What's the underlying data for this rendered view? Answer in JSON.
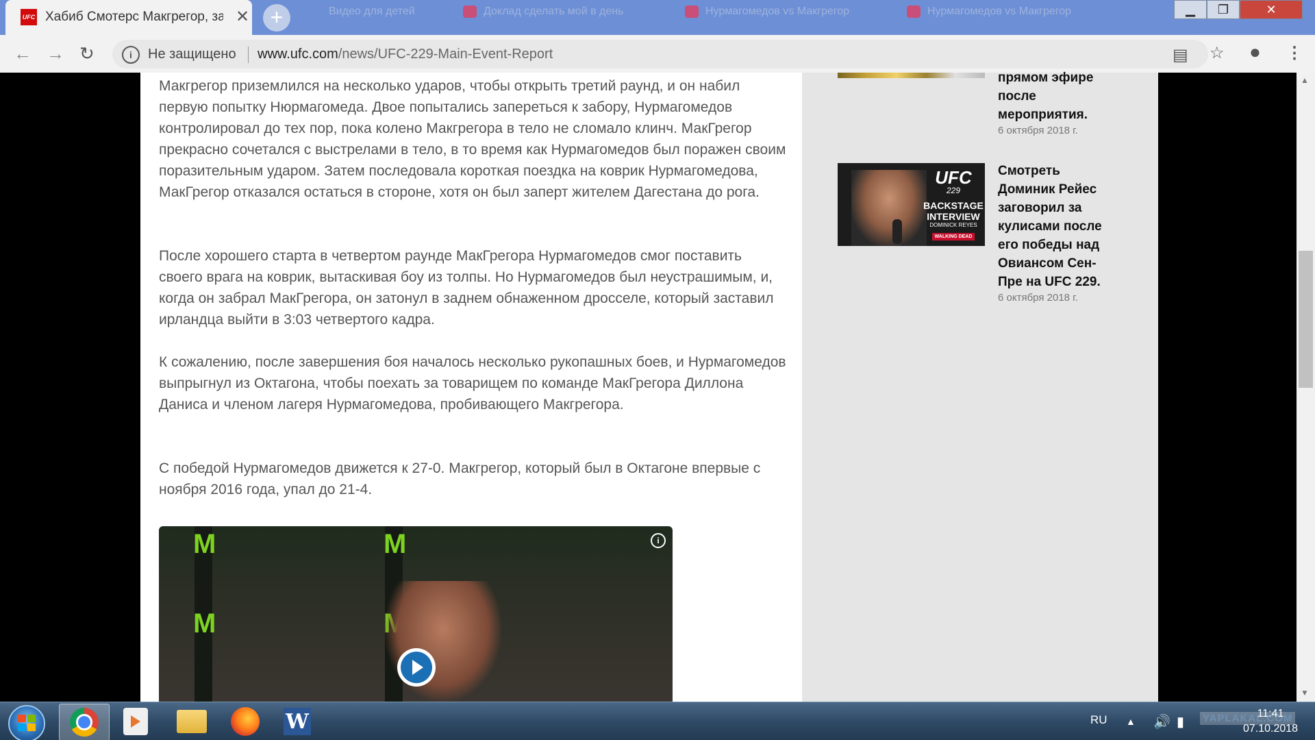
{
  "browser": {
    "active_tab": {
      "favicon_text": "UFC",
      "title": "Хабиб Смотерс Макгрегор, защ",
      "close_glyph": "✕"
    },
    "new_tab_glyph": "+",
    "background_tabs": [
      {
        "title": "Видео для детей",
        "close_glyph": "✕"
      },
      {
        "title": "Доклад сделать мой в день",
        "close_glyph": "✕"
      },
      {
        "title": "Нурмагомедов vs Макгрегор",
        "close_glyph": "✕"
      },
      {
        "title": "Нурмагомедов vs Макгрегор",
        "close_glyph": "✕"
      }
    ],
    "window_controls": {
      "minimize": "▁",
      "maximize": "❐",
      "close": "✕"
    },
    "address_bar": {
      "security_label": "Не защищено",
      "url_domain": "www.ufc.com",
      "url_path": "/news/UFC-229-Main-Event-Report"
    }
  },
  "article": {
    "paragraphs": [
      "Макгрегор приземлился на несколько ударов, чтобы открыть третий раунд, и он набил первую попытку Нюрмагомеда. Двое попытались запереться к забору, Нурмагомедов контролировал до тех пор, пока колено Макгрегора в тело не сломало клинч. МакГрегор прекрасно сочетался с выстрелами в тело, в то время как Нурмагомедов был поражен своим поразительным ударом. Затем последовала короткая поездка на коврик Нурмагомедова, МакГрегор отказался остаться в стороне, хотя он был заперт жителем Дагестана до рога.",
      "После хорошего старта в четвертом раунде МакГрегора Нурмагомедов смог поставить своего врага на коврик, вытаскивая боу из толпы. Но Нурмагомедов был неустрашимым, и, когда он забрал МакГрегора, он затонул в заднем обнаженном дросселе, который заставил ирландца выйти в 3:03 четвертого кадра.",
      "К сожалению, после завершения боя началось несколько рукопашных боев, и Нурмагомедов выпрыгнул из Октагона, чтобы поехать за товарищем по команде МакГрегора Диллона Даниса и членом лагеря Нурмагомедова, пробивающего Макгрегора.",
      "С победой Нурмагомедов движется к 27-0. Макгрегор, который был в Октагоне впервые с ноября 2016 года, упал до 21-4."
    ],
    "video": {
      "info_glyph": "i"
    }
  },
  "sidebar": {
    "items": [
      {
        "title": "прямом эфире после мероприятия.",
        "date": "6 октября 2018 г."
      },
      {
        "title": "Смотреть Доминик Рейес заговорил за кулисами после его победы над Овиансом Сен-Пре на UFC 229.",
        "date": "6 октября 2018 г.",
        "thumb": {
          "brand": "UFC",
          "number": "229",
          "caption": "BACKSTAGE INTERVIEW",
          "name": "DOMINICK REYES",
          "badge": "WALKING DEAD"
        }
      }
    ]
  },
  "taskbar": {
    "language": "RU",
    "watermark": "YAPLAKAL.COM",
    "time": "11:41",
    "date": "07.10.2018"
  }
}
